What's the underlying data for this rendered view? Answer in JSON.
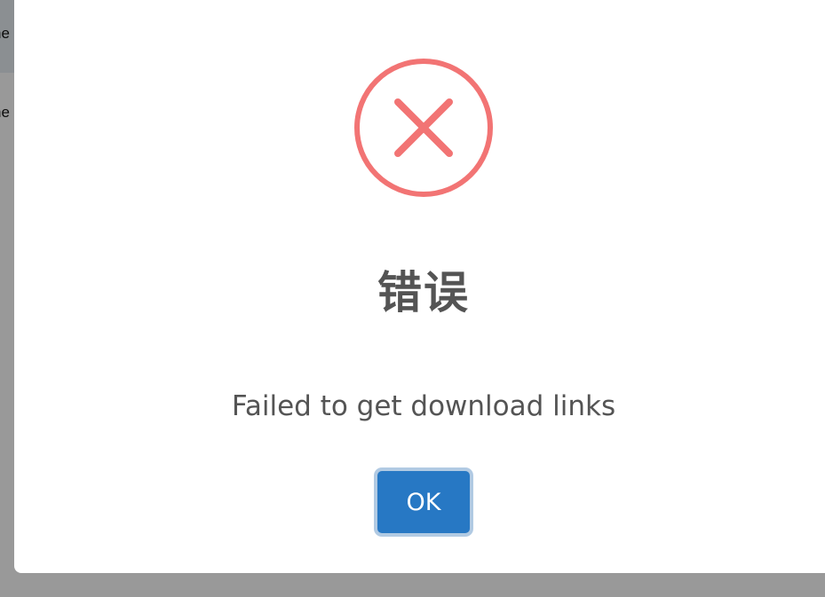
{
  "background_page": {
    "line1": "ne",
    "line2": "ne"
  },
  "dialog": {
    "icon": "error-x-circle-icon",
    "icon_color": "#f27474",
    "title": "错误",
    "message": "Failed to get download links",
    "confirm_label": "OK",
    "confirm_color": "#2778c4"
  }
}
